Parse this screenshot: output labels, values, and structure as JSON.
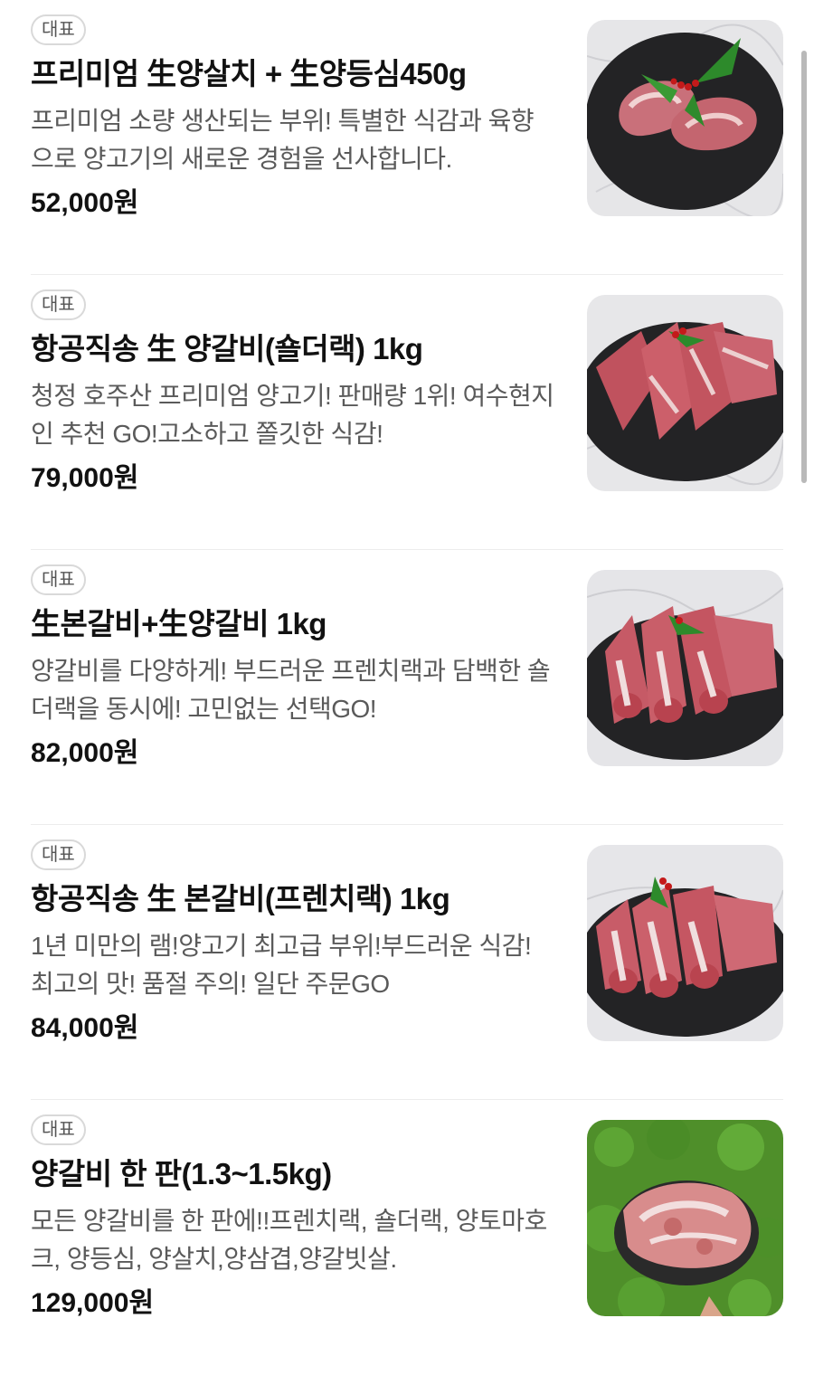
{
  "items": [
    {
      "badge": "대표",
      "title": "프리미엄 生양살치 + 生양등심450g",
      "desc": "프리미엄 소량 생산되는 부위! 특별한 식감과 육향으로 양고기의 새로운 경험을 선사합니다.",
      "price": "52,000원",
      "image": "lamb-steak-on-slate-plate"
    },
    {
      "badge": "대표",
      "title": "항공직송 生 양갈비(숄더랙) 1kg",
      "desc": "청정 호주산 프리미엄 양고기! 판매량 1위! 여수현지인 추천 GO!고소하고 쫄깃한 식감!",
      "price": "79,000원",
      "image": "lamb-shoulder-rack-on-slate-plate"
    },
    {
      "badge": "대표",
      "title": "生본갈비+生양갈비 1kg",
      "desc": "양갈비를 다양하게! 부드러운 프렌치랙과 담백한 숄더랙을 동시에! 고민없는 선택GO!",
      "price": "82,000원",
      "image": "lamb-rib-combo-on-slate-plate"
    },
    {
      "badge": "대표",
      "title": "항공직송 生 본갈비(프렌치랙) 1kg",
      "desc": "1년 미만의 램!양고기 최고급 부위!부드러운 식감! 최고의 맛! 품절 주의! 일단 주문GO",
      "price": "84,000원",
      "image": "lamb-french-rack-on-slate-plate"
    },
    {
      "badge": "대표",
      "title": "양갈비 한 판(1.3~1.5kg)",
      "desc": "모든 양갈비를 한 판에!!프렌치랙, 숄더랙, 양토마호크, 양등심, 양살치,양삼겹,양갈빗살.",
      "price": "129,000원",
      "image": "lamb-platter-on-green-background"
    }
  ]
}
